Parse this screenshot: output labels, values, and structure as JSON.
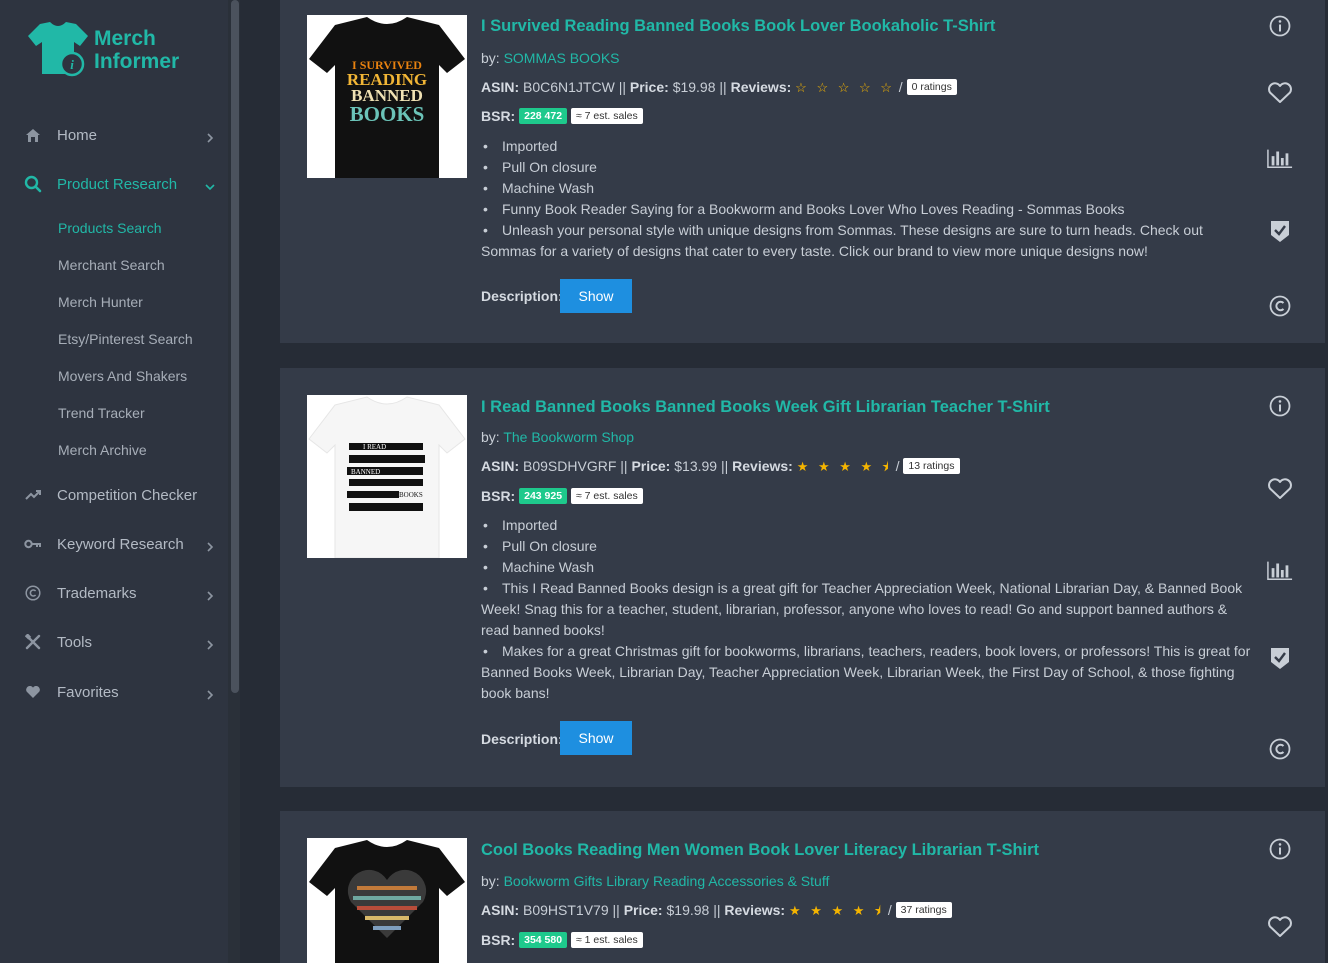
{
  "app": {
    "logo_line1": "Merch",
    "logo_line2": "Informer"
  },
  "sidebar": {
    "items": [
      {
        "label": "Home",
        "icon": "home-icon"
      },
      {
        "label": "Product Research",
        "icon": "search-icon"
      },
      {
        "label": "Competition Checker",
        "icon": "trend-icon"
      },
      {
        "label": "Keyword Research",
        "icon": "key-icon"
      },
      {
        "label": "Trademarks",
        "icon": "copyright-icon"
      },
      {
        "label": "Tools",
        "icon": "tools-icon"
      },
      {
        "label": "Favorites",
        "icon": "heart-icon"
      }
    ],
    "sub_items": [
      "Products Search",
      "Merchant Search",
      "Merch Hunter",
      "Etsy/Pinterest Search",
      "Movers And Shakers",
      "Trend Tracker",
      "Merch Archive"
    ]
  },
  "labels": {
    "by": "by:",
    "asin": "ASIN:",
    "price": "Price:",
    "reviews": "Reviews:",
    "bsr": "BSR:",
    "description": "Description:",
    "show": "Show",
    "sep": "||",
    "slash": "/"
  },
  "products": [
    {
      "title": "I Survived Reading Banned Books Book Lover Bookaholic T-Shirt",
      "brand": "SOMMAS BOOKS",
      "asin": "B0C6N1JTCW",
      "price": "$19.98",
      "stars": "☆ ☆ ☆ ☆ ☆",
      "rating_count": "0 ratings",
      "bsr": "228 472",
      "sales": "≈ 7 est. sales",
      "bullets": [
        "Imported",
        "Pull On closure",
        "Machine Wash",
        "Funny Book Reader Saying for a Bookworm and Books Lover Who Loves Reading - Sommas Books",
        "Unleash your personal style with unique designs from Sommas. These designs are sure to turn heads. Check out Sommas for a variety of designs that cater to every taste. Click our brand to view more unique designs now!"
      ],
      "shirt": {
        "color": "#111111",
        "art_lines": [
          "I SURVIVED",
          "READING",
          "BANNED",
          "BOOKS"
        ]
      }
    },
    {
      "title": "I Read Banned Books Banned Books Week Gift Librarian Teacher T-Shirt",
      "brand": "The Bookworm Shop",
      "asin": "B09SDHVGRF",
      "price": "$13.99",
      "stars": "★ ★ ★ ★ ⯨",
      "rating_count": "13 ratings",
      "bsr": "243 925",
      "sales": "≈ 7 est. sales",
      "bullets": [
        "Imported",
        "Pull On closure",
        "Machine Wash",
        "This I Read Banned Books design is a great gift for Teacher Appreciation Week, National Librarian Day, & Banned Book Week! Snag this for a teacher, student, librarian, professor, anyone who loves to read! Go and support banned authors & read banned books!",
        "Makes for a great Christmas gift for bookworms, librarians, teachers, readers, book lovers, or professors! This is great for Banned Books Week, Librarian Day, Teacher Appreciation Week, Librarian Week, the First Day of School, & those fighting book bans!"
      ],
      "shirt": {
        "color": "#f7f7f7",
        "art_lines": [
          "I READ",
          "BANNED",
          "BOOKS"
        ]
      }
    },
    {
      "title": "Cool Books Reading Men Women Book Lover Literacy Librarian T-Shirt",
      "brand": "Bookworm Gifts Library Reading Accessories & Stuff",
      "asin": "B09HST1V79",
      "price": "$19.98",
      "stars": "★ ★ ★ ★ ⯨",
      "rating_count": "37 ratings",
      "bsr": "354 580",
      "sales": "≈ 1 est. sales",
      "bullets": [],
      "shirt": {
        "color": "#111111",
        "art_lines": []
      }
    }
  ],
  "colors": {
    "accent": "#21b8a7",
    "bsr_badge": "#1ec98c",
    "show_button": "#1e8fe0",
    "star": "#f4b400"
  }
}
